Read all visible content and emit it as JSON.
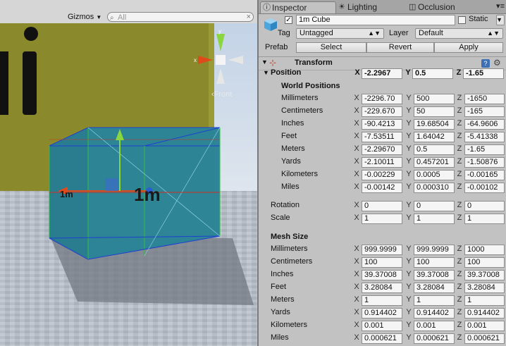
{
  "scene": {
    "gizmos_label": "Gizmos",
    "search_placeholder": "All",
    "view_label": "Front",
    "cube_text": "1m",
    "cube_text_left": "1m"
  },
  "inspector": {
    "tabs": [
      {
        "label": "Inspector",
        "icon": "info-icon"
      },
      {
        "label": "Lighting",
        "icon": "lighting-icon"
      },
      {
        "label": "Occlusion",
        "icon": "occlusion-icon"
      }
    ],
    "object_name": "1m Cube",
    "active_checked": true,
    "static_label": "Static",
    "tag_label": "Tag",
    "tag_value": "Untagged",
    "layer_label": "Layer",
    "layer_value": "Default",
    "prefab_label": "Prefab",
    "prefab_buttons": [
      "Select",
      "Revert",
      "Apply"
    ],
    "transform_title": "Transform",
    "position": {
      "label": "Position",
      "x": "-2.2967",
      "y": "0.5",
      "z": "-1.65"
    },
    "world_positions_title": "World Positions",
    "world_positions": [
      {
        "label": "Millimeters",
        "x": "-2296.70",
        "y": "500",
        "z": "-1650"
      },
      {
        "label": "Centimeters",
        "x": "-229.670",
        "y": "50",
        "z": "-165"
      },
      {
        "label": "Inches",
        "x": "-90.4213",
        "y": "19.68504",
        "z": "-64.9606"
      },
      {
        "label": "Feet",
        "x": "-7.53511",
        "y": "1.64042",
        "z": "-5.41338"
      },
      {
        "label": "Meters",
        "x": "-2.29670",
        "y": "0.5",
        "z": "-1.65"
      },
      {
        "label": "Yards",
        "x": "-2.10011",
        "y": "0.457201",
        "z": "-1.50876"
      },
      {
        "label": "Kilometers",
        "x": "-0.00229",
        "y": "0.0005",
        "z": "-0.00165"
      },
      {
        "label": "Miles",
        "x": "-0.00142",
        "y": "0.000310",
        "z": "-0.00102"
      }
    ],
    "rotation": {
      "label": "Rotation",
      "x": "0",
      "y": "0",
      "z": "0"
    },
    "scale": {
      "label": "Scale",
      "x": "1",
      "y": "1",
      "z": "1"
    },
    "mesh_size_title": "Mesh Size",
    "mesh_size": [
      {
        "label": "Millimeters",
        "x": "999.9999",
        "y": "999.9999",
        "z": "1000"
      },
      {
        "label": "Centimeters",
        "x": "100",
        "y": "100",
        "z": "100"
      },
      {
        "label": "Inches",
        "x": "39.37008",
        "y": "39.37008",
        "z": "39.37008"
      },
      {
        "label": "Feet",
        "x": "3.28084",
        "y": "3.28084",
        "z": "3.28084"
      },
      {
        "label": "Meters",
        "x": "1",
        "y": "1",
        "z": "1"
      },
      {
        "label": "Yards",
        "x": "0.914402",
        "y": "0.914402",
        "z": "0.914402"
      },
      {
        "label": "Kilometers",
        "x": "0.001",
        "y": "0.001",
        "z": "0.001"
      },
      {
        "label": "Miles",
        "x": "0.000621",
        "y": "0.000621",
        "z": "0.000621"
      }
    ],
    "axis_labels": [
      "X",
      "Y",
      "Z"
    ]
  },
  "colors": {
    "wall": "#8a8a2c",
    "cube": "#2f8fa0",
    "gizmo_x": "#e04a1a",
    "gizmo_y": "#8ad640",
    "gizmo_z": "#2a5fd0"
  }
}
